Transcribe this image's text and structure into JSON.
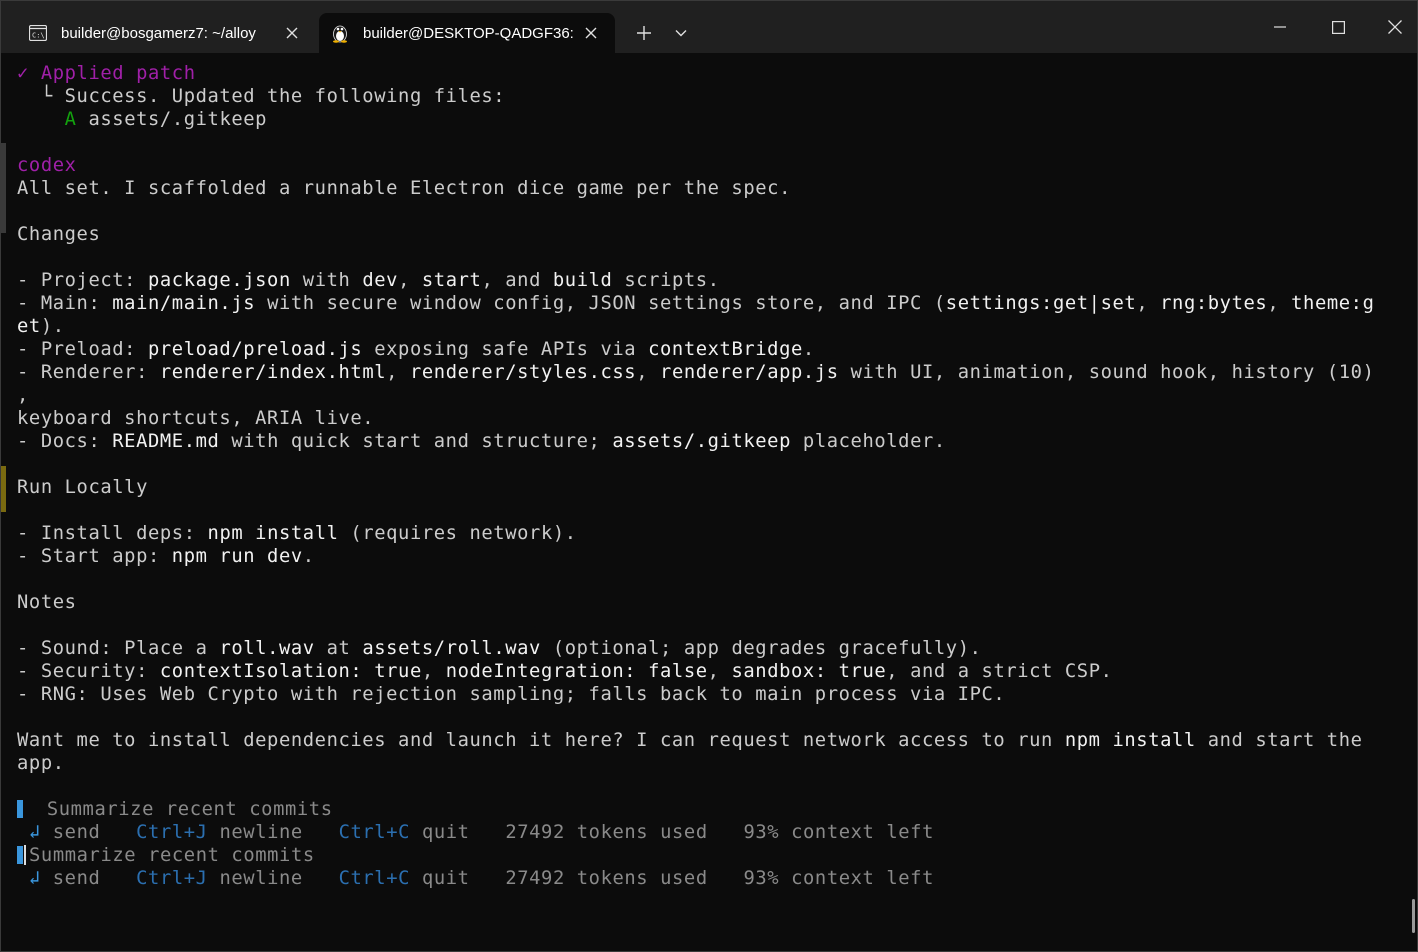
{
  "tabs": [
    {
      "label": "builder@bosgamerz7: ~/alloy",
      "icon": "cmd-icon"
    },
    {
      "label": "builder@DESKTOP-QADGF36:",
      "icon": "linux-penguin-icon"
    }
  ],
  "titlebar": {
    "new_tab": "+",
    "dropdown": "⌄"
  },
  "colors": {
    "accent_purple": "#a020a8",
    "accent_green": "#13a10e",
    "accent_blue": "#3a96dd",
    "bg": "#0c0c0c",
    "titlebar": "#202020"
  },
  "terminal": {
    "patch": {
      "check": "✓ ",
      "title": "Applied patch",
      "result": "  └ Success. Updated the following files:",
      "file_flag": "A",
      "file": " assets/.gitkeep"
    },
    "codex_label": "codex",
    "summary": "All set. I scaffolded a runnable Electron dice game per the spec.",
    "changes_heading": "Changes",
    "changes": {
      "project": [
        "- Project: ",
        "package.json",
        " with ",
        "dev",
        ", ",
        "start",
        ", and ",
        "build",
        " scripts."
      ],
      "main_1": [
        "- Main: ",
        "main/main.js",
        " with secure window config, JSON settings store, and IPC (",
        "settings:get|set",
        ", ",
        "rng:bytes",
        ", ",
        "theme:g"
      ],
      "main_2": [
        "et",
        ")."
      ],
      "preload": [
        "- Preload: ",
        "preload/preload.js",
        " exposing safe APIs via ",
        "contextBridge",
        "."
      ],
      "renderer_1": [
        "- Renderer: ",
        "renderer/index.html",
        ", ",
        "renderer/styles.css",
        ", ",
        "renderer/app.js",
        " with UI, animation, sound hook, history (10)"
      ],
      "renderer_2": ",",
      "renderer_3": "keyboard shortcuts, ARIA live.",
      "docs": [
        "- Docs: ",
        "README.md",
        " with quick start and structure; ",
        "assets/.gitkeep",
        " placeholder."
      ]
    },
    "run_heading": "Run Locally",
    "run": {
      "install": [
        "- Install deps: ",
        "npm install",
        " (requires network)."
      ],
      "start": [
        "- Start app: ",
        "npm run dev",
        "."
      ]
    },
    "notes_heading": "Notes",
    "notes": {
      "sound": [
        "- Sound: Place a ",
        "roll.wav",
        " at ",
        "assets/roll.wav",
        " (optional; app degrades gracefully)."
      ],
      "security": [
        "- Security: ",
        "contextIsolation: true",
        ", ",
        "nodeIntegration: false",
        ", ",
        "sandbox: true",
        ", and a strict CSP."
      ],
      "rng": "- RNG: Uses Web Crypto with rejection sampling; falls back to main process via IPC."
    },
    "question_1": [
      "Want me to install dependencies and launch it here? I can request network access to run ",
      "npm install",
      " and start the"
    ],
    "question_2": "app.",
    "prompt": {
      "placeholder": "Summarize recent commits",
      "enter_glyph": "↲",
      "send": " send",
      "newline_key": "Ctrl+J",
      "newline": " newline",
      "quit_key": "Ctrl+C",
      "quit": " quit",
      "tokens": "27492 tokens used",
      "context": "93% context left"
    }
  }
}
